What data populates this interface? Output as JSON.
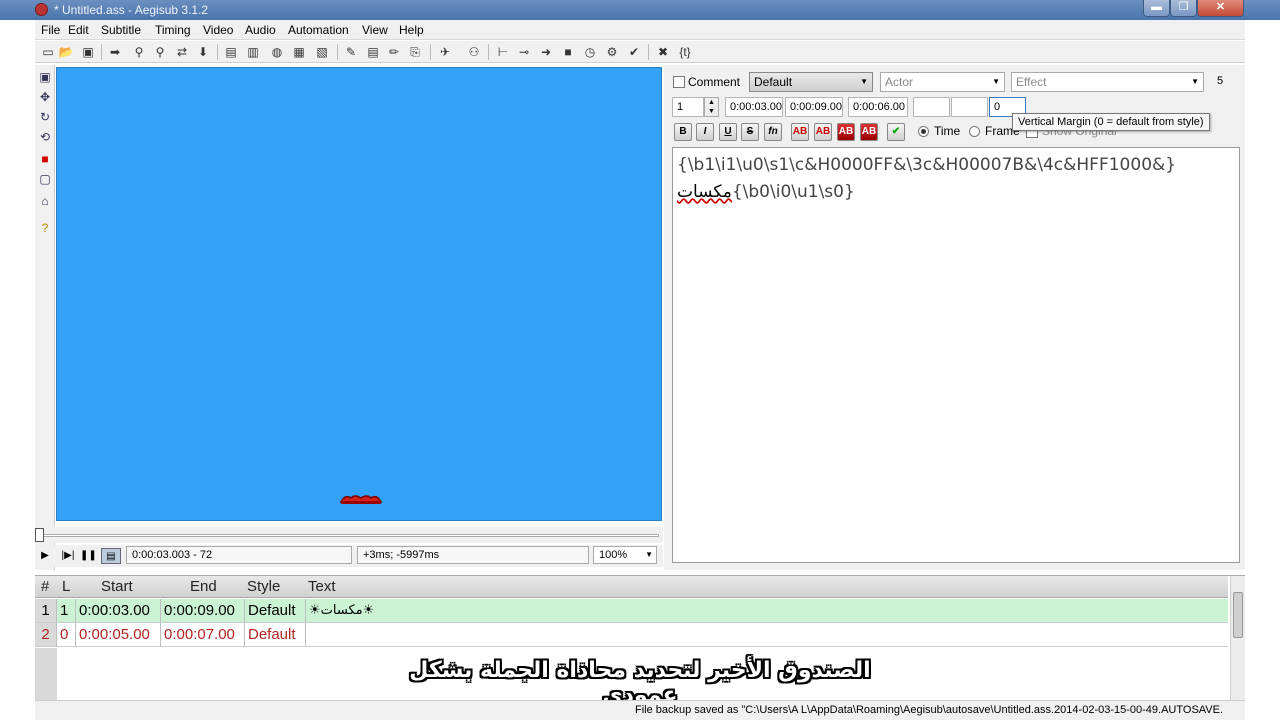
{
  "window": {
    "title": "* Untitled.ass - Aegisub 3.1.2",
    "min_glyph": "▬",
    "max_glyph": "❐",
    "close_glyph": "✕"
  },
  "menu": [
    "File",
    "Edit",
    "Subtitle",
    "Timing",
    "Video",
    "Audio",
    "Automation",
    "View",
    "Help"
  ],
  "toolbar_icons": [
    "new-file-icon",
    "open-file-icon",
    "save-icon",
    "jump-icon",
    "zoom-icon",
    "find-icon",
    "replace-icon",
    "paste-icon",
    "styles-icon",
    "properties-icon",
    "attachments-icon",
    "fonts-collector-icon",
    "shift-times-icon",
    "timing-processor-icon",
    "kanji-timer-icon",
    "spell-check-icon",
    "translation-icon",
    "resample-icon",
    "assistant-icon",
    "clock-icon",
    "snap-icon",
    "automation-icon",
    "options-icon",
    "tag-icon"
  ],
  "left_tools": [
    "crosshair-tool-icon",
    "drag-tool-icon",
    "rotate-z-icon",
    "rotate-xy-icon",
    "scale-icon",
    "clip-rect-icon",
    "vector-clip-icon",
    "help-icon"
  ],
  "video": {
    "subtitle_color": "#d62020",
    "background": "#33a1f5"
  },
  "video_controls": {
    "play_glyph": "▶",
    "play_line_glyph": "|▶|",
    "pause_glyph": "❚❚",
    "time": "0:00:03.003 - 72",
    "offset": "+3ms; -5997ms",
    "zoom": "100%"
  },
  "edit": {
    "comment_label": "Comment",
    "style": "Default",
    "actor_placeholder": "Actor",
    "effect_placeholder": "Effect",
    "effect_count": "5",
    "layer": "1",
    "start": "0:00:03.00",
    "end": "0:00:09.00",
    "duration": "0:00:06.00",
    "margin_v_value": "0",
    "format_buttons": [
      "B",
      "I",
      "U",
      "S",
      "fn",
      "AB",
      "AB",
      "AB",
      "AB",
      "✔"
    ],
    "time_label": "Time",
    "frame_label": "Frame",
    "show_original_label": "Show Original",
    "tooltip": "Vertical Margin (0 = default from style)",
    "text_line1": "{\\b1\\i1\\u0\\s1\\c&H0000FF&\\3c&H00007B&\\4c&HFF1000&}",
    "text_line2_arabic": "مكسات",
    "text_line2_tags": "{\\b0\\i0\\u1\\s0}"
  },
  "grid": {
    "headers": [
      "#",
      "L",
      "Start",
      "End",
      "Style",
      "Text"
    ],
    "rows": [
      {
        "num": "1",
        "layer": "1",
        "start": "0:00:03.00",
        "end": "0:00:09.00",
        "style": "Default",
        "text": "☀مكسات☀"
      },
      {
        "num": "2",
        "layer": "0",
        "start": "0:00:05.00",
        "end": "0:00:07.00",
        "style": "Default",
        "text": ""
      }
    ]
  },
  "overlay_caption": "الصندوق الأخير لتحديد محاذاة الجملة بشكل عمودي",
  "status": "File backup saved as \"C:\\Users\\A L\\AppData\\Roaming\\Aegisub\\autosave\\Untitled.ass.2014-02-03-15-00-49.AUTOSAVE."
}
